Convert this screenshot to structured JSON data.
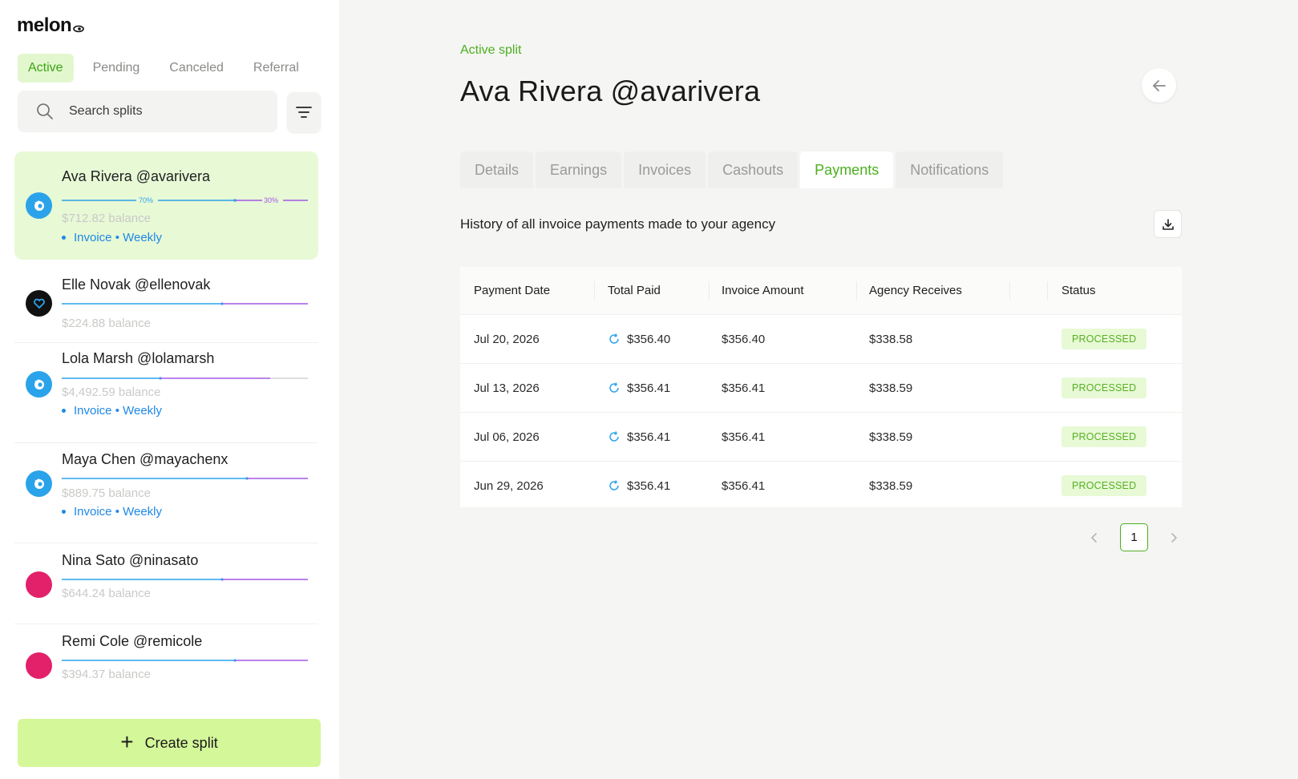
{
  "brand": {
    "name": "melon"
  },
  "sidebar": {
    "status_tabs": [
      {
        "label": "Active",
        "active": true
      },
      {
        "label": "Pending",
        "active": false
      },
      {
        "label": "Canceled",
        "active": false
      },
      {
        "label": "Referral",
        "active": false
      }
    ],
    "search": {
      "placeholder": "Search splits"
    },
    "splits": [
      {
        "name": "Ava Rivera @avarivera",
        "balance": "$712.82 balance",
        "meta": "Invoice • Weekly",
        "avatar": "blue-bird-icon",
        "selected": true,
        "split_left_label": "70%",
        "split_right_label": "30%",
        "split_fraction": 0.7
      },
      {
        "name": "Elle Novak @ellenovak",
        "balance": "$224.88 balance",
        "meta": "",
        "avatar": "heart-icon",
        "selected": false,
        "split_fraction": 0.65
      },
      {
        "name": "Lola Marsh @lolamarsh",
        "balance": "$4,492.59 balance",
        "meta": "Invoice • Weekly",
        "avatar": "blue-bird-icon",
        "selected": false,
        "split_fraction": 0.4
      },
      {
        "name": "Maya Chen @mayachenx",
        "balance": "$889.75 balance",
        "meta": "Invoice • Weekly",
        "avatar": "blue-bird-icon",
        "selected": false,
        "split_fraction": 0.75
      },
      {
        "name": "Nina Sato @ninasato",
        "balance": "$644.24 balance",
        "meta": "",
        "avatar": "pink-dot",
        "selected": false,
        "split_fraction": 0.65
      },
      {
        "name": "Remi Cole @remicole",
        "balance": "$394.37 balance",
        "meta": "",
        "avatar": "pink-dot",
        "selected": false,
        "split_fraction": 0.7
      }
    ],
    "create_button": {
      "label": "Create split",
      "icon": "plus-icon"
    }
  },
  "main": {
    "eyebrow": "Active split",
    "title": "Ava Rivera @avarivera",
    "tabs": [
      {
        "label": "Details",
        "active": false
      },
      {
        "label": "Earnings",
        "active": false
      },
      {
        "label": "Invoices",
        "active": false
      },
      {
        "label": "Cashouts",
        "active": false
      },
      {
        "label": "Payments",
        "active": true
      },
      {
        "label": "Notifications",
        "active": false
      }
    ],
    "section_description": "History of all invoice payments made to your agency",
    "table": {
      "columns": [
        "Payment Date",
        "Total Paid",
        "Invoice Amount",
        "Agency Receives",
        "Status"
      ],
      "rows": [
        {
          "date": "Jul 20, 2026",
          "total_paid": "$356.40",
          "invoice_amount": "$356.40",
          "agency_receives": "$338.58",
          "status": "PROCESSED"
        },
        {
          "date": "Jul 13, 2026",
          "total_paid": "$356.41",
          "invoice_amount": "$356.41",
          "agency_receives": "$338.59",
          "status": "PROCESSED"
        },
        {
          "date": "Jul 06, 2026",
          "total_paid": "$356.41",
          "invoice_amount": "$356.41",
          "agency_receives": "$338.59",
          "status": "PROCESSED"
        },
        {
          "date": "Jun 29, 2026",
          "total_paid": "$356.41",
          "invoice_amount": "$356.41",
          "agency_receives": "$338.59",
          "status": "PROCESSED"
        }
      ]
    },
    "pagination": {
      "current_page": "1"
    }
  },
  "colors": {
    "accent_green": "#4cb01e",
    "selected_bg": "#e8f9d6",
    "create_btn_bg": "#d4f79a",
    "link_blue": "#1e88e5",
    "bar_blue": "#2aa3ea",
    "bar_purple": "#a259e6"
  }
}
